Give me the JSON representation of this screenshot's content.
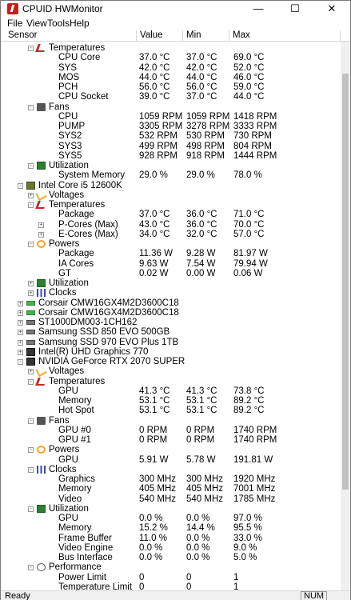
{
  "window": {
    "title": "CPUID HWMonitor",
    "minimize": "—",
    "maximize": "☐",
    "close": "✕"
  },
  "menu": [
    "File",
    "View",
    "Tools",
    "Help"
  ],
  "columns": [
    "Sensor",
    "Value",
    "Min",
    "Max"
  ],
  "rows": [
    {
      "indent": 2,
      "exp": "-",
      "icon": "temp",
      "name": "Temperatures",
      "val": "",
      "min": "",
      "max": ""
    },
    {
      "indent": 3,
      "name": "CPU Core",
      "val": "37.0 °C",
      "min": "37.0 °C",
      "max": "69.0 °C"
    },
    {
      "indent": 3,
      "name": "SYS",
      "val": "42.0 °C",
      "min": "42.0 °C",
      "max": "52.0 °C"
    },
    {
      "indent": 3,
      "name": "MOS",
      "val": "44.0 °C",
      "min": "44.0 °C",
      "max": "46.0 °C"
    },
    {
      "indent": 3,
      "name": "PCH",
      "val": "56.0 °C",
      "min": "56.0 °C",
      "max": "59.0 °C"
    },
    {
      "indent": 3,
      "name": "CPU Socket",
      "val": "39.0 °C",
      "min": "37.0 °C",
      "max": "44.0 °C"
    },
    {
      "indent": 2,
      "exp": "-",
      "icon": "fan",
      "name": "Fans",
      "val": "",
      "min": "",
      "max": ""
    },
    {
      "indent": 3,
      "name": "CPU",
      "val": "1059 RPM",
      "min": "1059 RPM",
      "max": "1418 RPM"
    },
    {
      "indent": 3,
      "name": "PUMP",
      "val": "3305 RPM",
      "min": "3278 RPM",
      "max": "3333 RPM"
    },
    {
      "indent": 3,
      "name": "SYS2",
      "val": "532 RPM",
      "min": "530 RPM",
      "max": "730 RPM"
    },
    {
      "indent": 3,
      "name": "SYS3",
      "val": "499 RPM",
      "min": "498 RPM",
      "max": "804 RPM"
    },
    {
      "indent": 3,
      "name": "SYS5",
      "val": "928 RPM",
      "min": "918 RPM",
      "max": "1444 RPM"
    },
    {
      "indent": 2,
      "exp": "-",
      "icon": "util",
      "name": "Utilization",
      "val": "",
      "min": "",
      "max": ""
    },
    {
      "indent": 3,
      "name": "System Memory",
      "val": "29.0 %",
      "min": "29.0 %",
      "max": "78.0 %"
    },
    {
      "indent": 1,
      "exp": "-",
      "icon": "cpu",
      "name": "Intel Core i5 12600K",
      "val": "",
      "min": "",
      "max": ""
    },
    {
      "indent": 2,
      "exp": "+",
      "icon": "volt",
      "name": "Voltages",
      "val": "",
      "min": "",
      "max": ""
    },
    {
      "indent": 2,
      "exp": "-",
      "icon": "temp",
      "name": "Temperatures",
      "val": "",
      "min": "",
      "max": ""
    },
    {
      "indent": 3,
      "name": "Package",
      "val": "37.0 °C",
      "min": "36.0 °C",
      "max": "71.0 °C"
    },
    {
      "indent": 3,
      "exp": "+",
      "name": "P-Cores (Max)",
      "val": "43.0 °C",
      "min": "36.0 °C",
      "max": "70.0 °C"
    },
    {
      "indent": 3,
      "exp": "+",
      "name": "E-Cores (Max)",
      "val": "34.0 °C",
      "min": "32.0 °C",
      "max": "57.0 °C"
    },
    {
      "indent": 2,
      "exp": "-",
      "icon": "power",
      "name": "Powers",
      "val": "",
      "min": "",
      "max": ""
    },
    {
      "indent": 3,
      "name": "Package",
      "val": "11.36 W",
      "min": "9.28 W",
      "max": "81.97 W"
    },
    {
      "indent": 3,
      "name": "IA Cores",
      "val": "9.63 W",
      "min": "7.54 W",
      "max": "79.94 W"
    },
    {
      "indent": 3,
      "name": "GT",
      "val": "0.02 W",
      "min": "0.00 W",
      "max": "0.06 W"
    },
    {
      "indent": 2,
      "exp": "+",
      "icon": "util",
      "name": "Utilization",
      "val": "",
      "min": "",
      "max": ""
    },
    {
      "indent": 2,
      "exp": "+",
      "icon": "clock",
      "name": "Clocks",
      "val": "",
      "min": "",
      "max": ""
    },
    {
      "indent": 1,
      "exp": "+",
      "icon": "mem",
      "name": "Corsair CMW16GX4M2D3600C18",
      "val": "",
      "min": "",
      "max": ""
    },
    {
      "indent": 1,
      "exp": "+",
      "icon": "mem",
      "name": "Corsair CMW16GX4M2D3600C18",
      "val": "",
      "min": "",
      "max": ""
    },
    {
      "indent": 1,
      "exp": "+",
      "icon": "disk",
      "name": "ST1000DM003-1CH162",
      "val": "",
      "min": "",
      "max": ""
    },
    {
      "indent": 1,
      "exp": "+",
      "icon": "disk",
      "name": "Samsung SSD 850 EVO 500GB",
      "val": "",
      "min": "",
      "max": ""
    },
    {
      "indent": 1,
      "exp": "+",
      "icon": "disk",
      "name": "Samsung SSD 970 EVO Plus 1TB",
      "val": "",
      "min": "",
      "max": ""
    },
    {
      "indent": 1,
      "exp": "+",
      "icon": "gpu",
      "name": "Intel(R) UHD Graphics 770",
      "val": "",
      "min": "",
      "max": ""
    },
    {
      "indent": 1,
      "exp": "-",
      "icon": "gpu",
      "name": "NVIDIA GeForce RTX 2070 SUPER",
      "val": "",
      "min": "",
      "max": ""
    },
    {
      "indent": 2,
      "exp": "+",
      "icon": "volt",
      "name": "Voltages",
      "val": "",
      "min": "",
      "max": ""
    },
    {
      "indent": 2,
      "exp": "-",
      "icon": "temp",
      "name": "Temperatures",
      "val": "",
      "min": "",
      "max": ""
    },
    {
      "indent": 3,
      "name": "GPU",
      "val": "41.3 °C",
      "min": "41.3 °C",
      "max": "73.8 °C"
    },
    {
      "indent": 3,
      "name": "Memory",
      "val": "53.1 °C",
      "min": "53.1 °C",
      "max": "89.2 °C"
    },
    {
      "indent": 3,
      "name": "Hot Spot",
      "val": "53.1 °C",
      "min": "53.1 °C",
      "max": "89.2 °C"
    },
    {
      "indent": 2,
      "exp": "-",
      "icon": "fan",
      "name": "Fans",
      "val": "",
      "min": "",
      "max": ""
    },
    {
      "indent": 3,
      "name": "GPU #0",
      "val": "0 RPM",
      "min": "0 RPM",
      "max": "1740 RPM"
    },
    {
      "indent": 3,
      "name": "GPU #1",
      "val": "0 RPM",
      "min": "0 RPM",
      "max": "1740 RPM"
    },
    {
      "indent": 2,
      "exp": "-",
      "icon": "power",
      "name": "Powers",
      "val": "",
      "min": "",
      "max": ""
    },
    {
      "indent": 3,
      "name": "GPU",
      "val": "5.91 W",
      "min": "5.78 W",
      "max": "191.81 W"
    },
    {
      "indent": 2,
      "exp": "-",
      "icon": "clock",
      "name": "Clocks",
      "val": "",
      "min": "",
      "max": ""
    },
    {
      "indent": 3,
      "name": "Graphics",
      "val": "300 MHz",
      "min": "300 MHz",
      "max": "1920 MHz"
    },
    {
      "indent": 3,
      "name": "Memory",
      "val": "405 MHz",
      "min": "405 MHz",
      "max": "7001 MHz"
    },
    {
      "indent": 3,
      "name": "Video",
      "val": "540 MHz",
      "min": "540 MHz",
      "max": "1785 MHz"
    },
    {
      "indent": 2,
      "exp": "-",
      "icon": "util",
      "name": "Utilization",
      "val": "",
      "min": "",
      "max": ""
    },
    {
      "indent": 3,
      "name": "GPU",
      "val": "0.0 %",
      "min": "0.0 %",
      "max": "97.0 %"
    },
    {
      "indent": 3,
      "name": "Memory",
      "val": "15.2 %",
      "min": "14.4 %",
      "max": "95.5 %"
    },
    {
      "indent": 3,
      "name": "Frame Buffer",
      "val": "11.0 %",
      "min": "0.0 %",
      "max": "33.0 %"
    },
    {
      "indent": 3,
      "name": "Video Engine",
      "val": "0.0 %",
      "min": "0.0 %",
      "max": "9.0 %"
    },
    {
      "indent": 3,
      "name": "Bus Interface",
      "val": "0.0 %",
      "min": "0.0 %",
      "max": "5.0 %"
    },
    {
      "indent": 2,
      "exp": "-",
      "icon": "perf",
      "name": "Performance",
      "val": "",
      "min": "",
      "max": ""
    },
    {
      "indent": 3,
      "name": "Power Limit",
      "val": "0",
      "min": "0",
      "max": "1"
    },
    {
      "indent": 3,
      "name": "Temperature Limit",
      "val": "0",
      "min": "0",
      "max": "1"
    }
  ],
  "status": {
    "ready": "Ready",
    "num": "NUM"
  }
}
